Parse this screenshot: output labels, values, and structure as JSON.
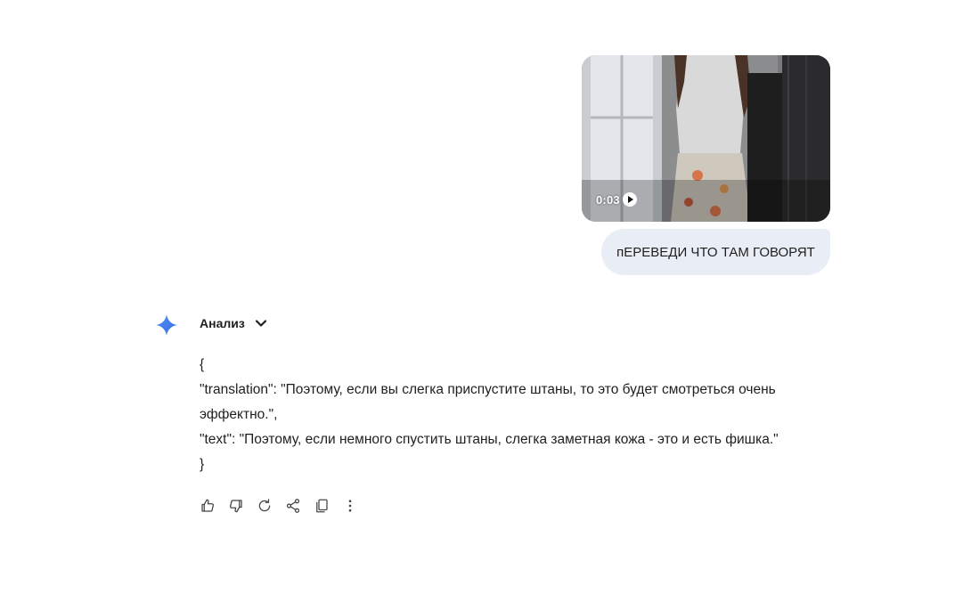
{
  "colors": {
    "user_bubble_bg": "#e9eef6",
    "accent_blue": "#4285f4",
    "icon_gray": "#444746"
  },
  "video": {
    "timestamp": "0:03",
    "play_icon": "play-icon"
  },
  "user_message": "пЕРЕВЕДИ ЧТО ТАМ ГОВОРЯТ",
  "assistant": {
    "logo_icon": "gemini-sparkle-icon",
    "analysis_label": "Анализ",
    "response_lines": [
      "{",
      "\"translation\": \"Поэтому, если вы слегка приспустите штаны, то это будет смотреться очень эффектно.\",",
      "\"text\": \"Поэтому, если немного спустить штаны, слегка заметная кожа - это и есть фишка.\"",
      "}"
    ]
  },
  "actions": [
    {
      "icon": "thumbs-up-icon"
    },
    {
      "icon": "thumbs-down-icon"
    },
    {
      "icon": "regenerate-icon"
    },
    {
      "icon": "share-icon"
    },
    {
      "icon": "copy-icon"
    },
    {
      "icon": "more-vert-icon"
    }
  ]
}
